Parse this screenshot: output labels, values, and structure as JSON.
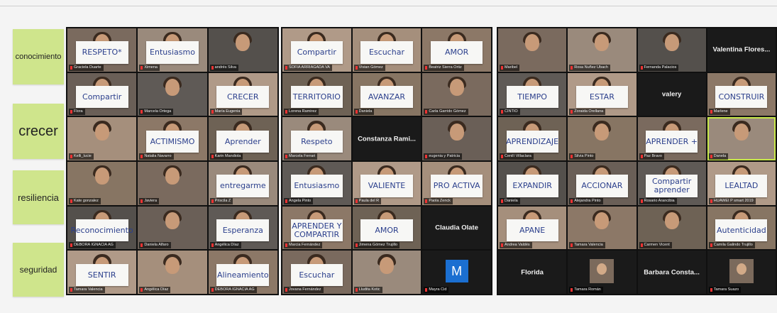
{
  "stickies": [
    {
      "label": "conocimiento"
    },
    {
      "label": "crecer"
    },
    {
      "label": "resiliencia"
    },
    {
      "label": "seguridad"
    }
  ],
  "panels": [
    {
      "tiles": [
        {
          "sign": "RESPETO*",
          "name": "Graciela Duarte"
        },
        {
          "sign": "Entusiasmo",
          "name": "Ximena"
        },
        {
          "sign": "",
          "name": "andrés Silva"
        },
        {
          "sign": "Compartir",
          "name": "Flora"
        },
        {
          "sign": "",
          "name": "Marcela Ortega"
        },
        {
          "sign": "CRECER",
          "name": "María Eugenia"
        },
        {
          "sign": "",
          "name": "Kelli_lucie"
        },
        {
          "sign": "ACTIMISMO",
          "name": "Natalia Navarro"
        },
        {
          "sign": "Aprender",
          "name": "Karin Mandiola"
        },
        {
          "sign": "",
          "name": "Kate gonzalez"
        },
        {
          "sign": "",
          "name": "Javiera"
        },
        {
          "sign": "entregarme",
          "name": "Priscila Z"
        },
        {
          "sign": "Reconocimiento",
          "name": "DEBORA IGNACIA AG"
        },
        {
          "sign": "",
          "name": "Daniela Alfaro"
        },
        {
          "sign": "Esperanza",
          "name": "Angélica Díaz"
        },
        {
          "sign": "SENTIR",
          "name": "Tamara Valencia"
        },
        {
          "sign": "",
          "name": "Angélica Díaz"
        },
        {
          "sign": "Alineamiento",
          "name": "DEBORA IGNACIA AG"
        }
      ]
    },
    {
      "tiles": [
        {
          "sign": "Compartir",
          "name": "SOFIA ARRIAGADA VA"
        },
        {
          "sign": "Escuchar",
          "name": "Vivian Gómez"
        },
        {
          "sign": "AMOR",
          "name": "Beatriz Sierra Ortiz"
        },
        {
          "sign": "TERRITORIO",
          "name": "Lorena Ramirez"
        },
        {
          "sign": "AVANZAR",
          "name": "Daniela"
        },
        {
          "sign": "",
          "name": "Carla Garrido Gómez"
        },
        {
          "sign": "Respeto",
          "name": "Marcela Ferrari"
        },
        {
          "big": "Constanza Rami..."
        },
        {
          "sign": "",
          "name": "eugenia y Patricia"
        },
        {
          "sign": "Entusiasmo",
          "name": "Angela Pinto"
        },
        {
          "sign": "VALIENTE",
          "name": "Paula del R"
        },
        {
          "sign": "PRO ACTIVA",
          "name": "Paola Zenck"
        },
        {
          "sign": "APRENDER Y COMPARTIR",
          "name": "Marcia Fernández"
        },
        {
          "sign": "AMOR",
          "name": "Jimena Gómez Trujillo"
        },
        {
          "big": "Claudia Olate"
        },
        {
          "sign": "Escuchar",
          "name": "Jovana Fernández"
        },
        {
          "sign": "",
          "name": "Lludita Kotic"
        },
        {
          "avatar": "M",
          "name": "Mayra Cid"
        }
      ]
    },
    {
      "tiles": [
        {
          "sign": "",
          "name": "Maribel"
        },
        {
          "sign": "",
          "name": "Rosa Nuñez Ubach"
        },
        {
          "sign": "",
          "name": "Fernanda Palacios"
        },
        {
          "big": "Valentina Flores..."
        },
        {
          "sign": "TIEMPO",
          "name": "CINTIO"
        },
        {
          "sign": "ESTAR",
          "name": "Zoraida Orellana"
        },
        {
          "big": "valery"
        },
        {
          "sign": "CONSTRUIR",
          "name": "Marlene"
        },
        {
          "sign": "APRENDIZAJE",
          "name": "Cenilí Villaclara"
        },
        {
          "sign": "",
          "name": "Silvia Pinto"
        },
        {
          "sign": "APRENDER +",
          "name": "Paz Bravo"
        },
        {
          "sign": "",
          "name": "Danela",
          "active": true
        },
        {
          "sign": "EXPANDIR",
          "name": "Daniela"
        },
        {
          "sign": "ACCIONAR",
          "name": "Alejandra Pinto"
        },
        {
          "sign": "Compartir aprender",
          "name": "Rosario Arancibia"
        },
        {
          "sign": "LEALTAD",
          "name": "HUAWEI P smart 2019"
        },
        {
          "sign": "APANE",
          "name": "Andrea Valdés"
        },
        {
          "sign": "",
          "name": "Tamara Valencia"
        },
        {
          "sign": "",
          "name": "Carmen Vicent"
        },
        {
          "sign": "Autenticidad",
          "name": "Camila Galindo Trujillo"
        },
        {
          "big": "Florida"
        },
        {
          "photo": true,
          "name": "Tamara Román"
        },
        {
          "big": "Barbara Consta..."
        },
        {
          "photo": true,
          "name": "Tamara Suazo"
        }
      ]
    }
  ]
}
